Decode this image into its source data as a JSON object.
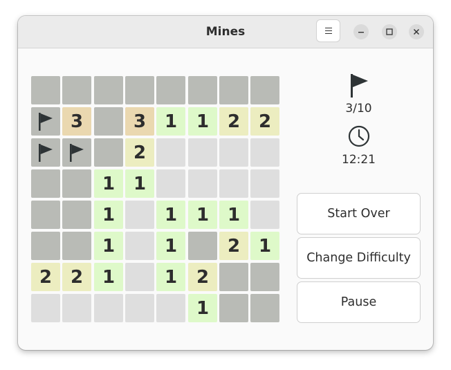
{
  "window": {
    "title": "Mines"
  },
  "header": {
    "menu_icon": "hamburger-menu-icon",
    "controls": [
      "minimize-icon",
      "maximize-icon",
      "close-icon"
    ]
  },
  "status": {
    "flags": "3/10",
    "flag_icon": "flag-icon",
    "time": "12:21",
    "clock_icon": "clock-icon"
  },
  "actions": {
    "start_over": "Start Over",
    "change_difficulty": "Change Difficulty",
    "pause": "Pause"
  },
  "board": {
    "rows": 8,
    "cols": 8,
    "legend": {
      "H": "unrevealed",
      "F": "flagged",
      "E": "revealed-empty",
      "1": "number",
      "2": "number",
      "3": "number"
    },
    "grid": [
      [
        "H",
        "H",
        "H",
        "H",
        "H",
        "H",
        "H",
        "H"
      ],
      [
        "F",
        "3",
        "H",
        "3",
        "1",
        "1",
        "2",
        "2"
      ],
      [
        "F",
        "F",
        "H",
        "2",
        "E",
        "E",
        "E",
        "E"
      ],
      [
        "H",
        "H",
        "1",
        "1",
        "E",
        "E",
        "E",
        "E"
      ],
      [
        "H",
        "H",
        "1",
        "E",
        "1",
        "1",
        "1",
        "E"
      ],
      [
        "H",
        "H",
        "1",
        "E",
        "1",
        "H",
        "2",
        "1"
      ],
      [
        "2",
        "2",
        "1",
        "E",
        "1",
        "2",
        "H",
        "H"
      ],
      [
        "E",
        "E",
        "E",
        "E",
        "E",
        "1",
        "H",
        "H"
      ]
    ]
  },
  "colors": {
    "unrevealed": "#b9bbb6",
    "empty": "#dedede",
    "one": "#def9c9",
    "two": "#ecedc0",
    "three": "#ead8b0",
    "text": "#2d2d2d"
  }
}
